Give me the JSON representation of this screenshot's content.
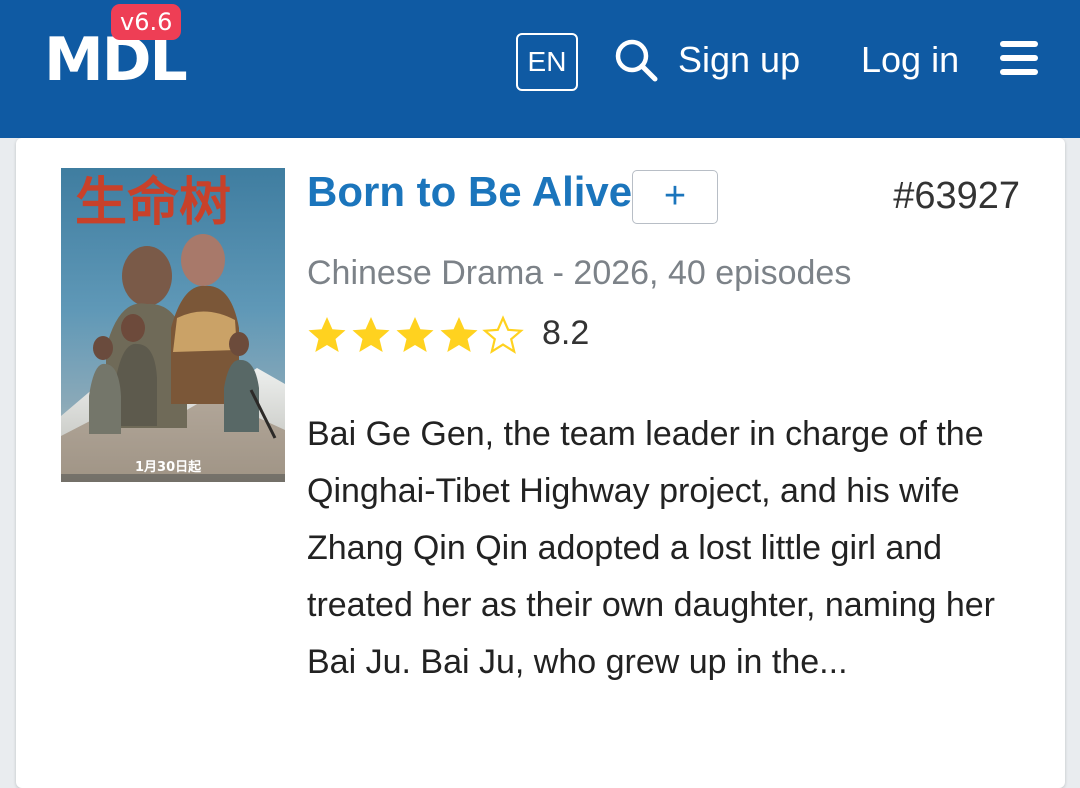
{
  "header": {
    "logo": "MDL",
    "version": "v6.6",
    "language": "EN",
    "signup_label": "Sign up",
    "login_label": "Log in",
    "search_icon": "search-icon",
    "menu_icon": "hamburger-menu-icon",
    "background_color": "#0f5aa3",
    "badge_color": "#ee3e55"
  },
  "drama": {
    "poster_icon": "drama-poster",
    "poster_text": "1月30日起",
    "title": "Born to Be Alive",
    "add_label": "+",
    "rank": "#63927",
    "subtitle": "Chinese Drama - 2026, 40 episodes",
    "rating_value": "8.2",
    "stars_filled": 4,
    "stars_total": 5,
    "synopsis": "Bai Ge Gen, the team leader in charge of the Qinghai-Tibet Highway project, and his wife Zhang Qin Qin adopted a lost little girl and treated her as their own daughter, naming her Bai Ju. Bai Ju, who grew up in the...",
    "title_color": "#1b75bc",
    "star_color": "#ffd21f"
  }
}
